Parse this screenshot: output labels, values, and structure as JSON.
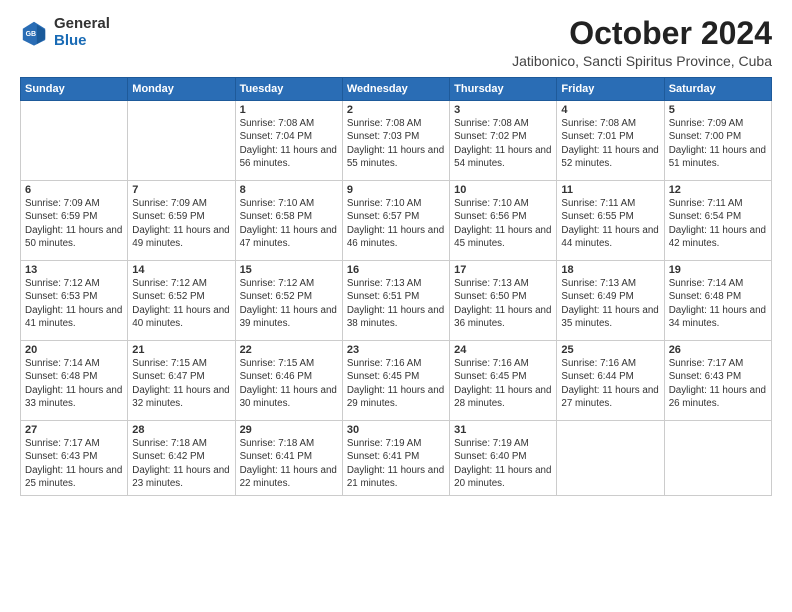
{
  "header": {
    "logo_general": "General",
    "logo_blue": "Blue",
    "month_title": "October 2024",
    "location": "Jatibonico, Sancti Spiritus Province, Cuba"
  },
  "weekdays": [
    "Sunday",
    "Monday",
    "Tuesday",
    "Wednesday",
    "Thursday",
    "Friday",
    "Saturday"
  ],
  "weeks": [
    [
      {
        "day": "",
        "info": ""
      },
      {
        "day": "",
        "info": ""
      },
      {
        "day": "1",
        "info": "Sunrise: 7:08 AM\nSunset: 7:04 PM\nDaylight: 11 hours and 56 minutes."
      },
      {
        "day": "2",
        "info": "Sunrise: 7:08 AM\nSunset: 7:03 PM\nDaylight: 11 hours and 55 minutes."
      },
      {
        "day": "3",
        "info": "Sunrise: 7:08 AM\nSunset: 7:02 PM\nDaylight: 11 hours and 54 minutes."
      },
      {
        "day": "4",
        "info": "Sunrise: 7:08 AM\nSunset: 7:01 PM\nDaylight: 11 hours and 52 minutes."
      },
      {
        "day": "5",
        "info": "Sunrise: 7:09 AM\nSunset: 7:00 PM\nDaylight: 11 hours and 51 minutes."
      }
    ],
    [
      {
        "day": "6",
        "info": "Sunrise: 7:09 AM\nSunset: 6:59 PM\nDaylight: 11 hours and 50 minutes."
      },
      {
        "day": "7",
        "info": "Sunrise: 7:09 AM\nSunset: 6:59 PM\nDaylight: 11 hours and 49 minutes."
      },
      {
        "day": "8",
        "info": "Sunrise: 7:10 AM\nSunset: 6:58 PM\nDaylight: 11 hours and 47 minutes."
      },
      {
        "day": "9",
        "info": "Sunrise: 7:10 AM\nSunset: 6:57 PM\nDaylight: 11 hours and 46 minutes."
      },
      {
        "day": "10",
        "info": "Sunrise: 7:10 AM\nSunset: 6:56 PM\nDaylight: 11 hours and 45 minutes."
      },
      {
        "day": "11",
        "info": "Sunrise: 7:11 AM\nSunset: 6:55 PM\nDaylight: 11 hours and 44 minutes."
      },
      {
        "day": "12",
        "info": "Sunrise: 7:11 AM\nSunset: 6:54 PM\nDaylight: 11 hours and 42 minutes."
      }
    ],
    [
      {
        "day": "13",
        "info": "Sunrise: 7:12 AM\nSunset: 6:53 PM\nDaylight: 11 hours and 41 minutes."
      },
      {
        "day": "14",
        "info": "Sunrise: 7:12 AM\nSunset: 6:52 PM\nDaylight: 11 hours and 40 minutes."
      },
      {
        "day": "15",
        "info": "Sunrise: 7:12 AM\nSunset: 6:52 PM\nDaylight: 11 hours and 39 minutes."
      },
      {
        "day": "16",
        "info": "Sunrise: 7:13 AM\nSunset: 6:51 PM\nDaylight: 11 hours and 38 minutes."
      },
      {
        "day": "17",
        "info": "Sunrise: 7:13 AM\nSunset: 6:50 PM\nDaylight: 11 hours and 36 minutes."
      },
      {
        "day": "18",
        "info": "Sunrise: 7:13 AM\nSunset: 6:49 PM\nDaylight: 11 hours and 35 minutes."
      },
      {
        "day": "19",
        "info": "Sunrise: 7:14 AM\nSunset: 6:48 PM\nDaylight: 11 hours and 34 minutes."
      }
    ],
    [
      {
        "day": "20",
        "info": "Sunrise: 7:14 AM\nSunset: 6:48 PM\nDaylight: 11 hours and 33 minutes."
      },
      {
        "day": "21",
        "info": "Sunrise: 7:15 AM\nSunset: 6:47 PM\nDaylight: 11 hours and 32 minutes."
      },
      {
        "day": "22",
        "info": "Sunrise: 7:15 AM\nSunset: 6:46 PM\nDaylight: 11 hours and 30 minutes."
      },
      {
        "day": "23",
        "info": "Sunrise: 7:16 AM\nSunset: 6:45 PM\nDaylight: 11 hours and 29 minutes."
      },
      {
        "day": "24",
        "info": "Sunrise: 7:16 AM\nSunset: 6:45 PM\nDaylight: 11 hours and 28 minutes."
      },
      {
        "day": "25",
        "info": "Sunrise: 7:16 AM\nSunset: 6:44 PM\nDaylight: 11 hours and 27 minutes."
      },
      {
        "day": "26",
        "info": "Sunrise: 7:17 AM\nSunset: 6:43 PM\nDaylight: 11 hours and 26 minutes."
      }
    ],
    [
      {
        "day": "27",
        "info": "Sunrise: 7:17 AM\nSunset: 6:43 PM\nDaylight: 11 hours and 25 minutes."
      },
      {
        "day": "28",
        "info": "Sunrise: 7:18 AM\nSunset: 6:42 PM\nDaylight: 11 hours and 23 minutes."
      },
      {
        "day": "29",
        "info": "Sunrise: 7:18 AM\nSunset: 6:41 PM\nDaylight: 11 hours and 22 minutes."
      },
      {
        "day": "30",
        "info": "Sunrise: 7:19 AM\nSunset: 6:41 PM\nDaylight: 11 hours and 21 minutes."
      },
      {
        "day": "31",
        "info": "Sunrise: 7:19 AM\nSunset: 6:40 PM\nDaylight: 11 hours and 20 minutes."
      },
      {
        "day": "",
        "info": ""
      },
      {
        "day": "",
        "info": ""
      }
    ]
  ]
}
